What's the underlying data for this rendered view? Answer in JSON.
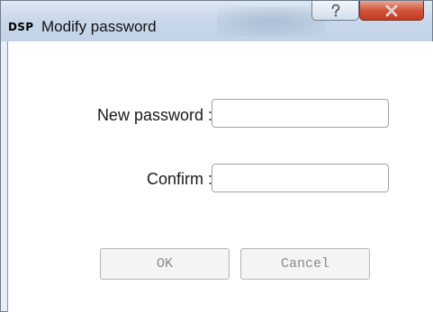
{
  "window": {
    "app_icon_text": "DSP",
    "title": "Modify password",
    "help_icon": "question-mark-icon",
    "close_icon": "close-x-icon"
  },
  "form": {
    "new_password_label": "New password :",
    "new_password_value": "",
    "confirm_label": "Confirm :",
    "confirm_value": ""
  },
  "buttons": {
    "ok_label": "OK",
    "cancel_label": "Cancel"
  },
  "colors": {
    "close_button": "#c94a2e",
    "titlebar": "#c9d8ea",
    "disabled_text": "#8a8a8a"
  }
}
